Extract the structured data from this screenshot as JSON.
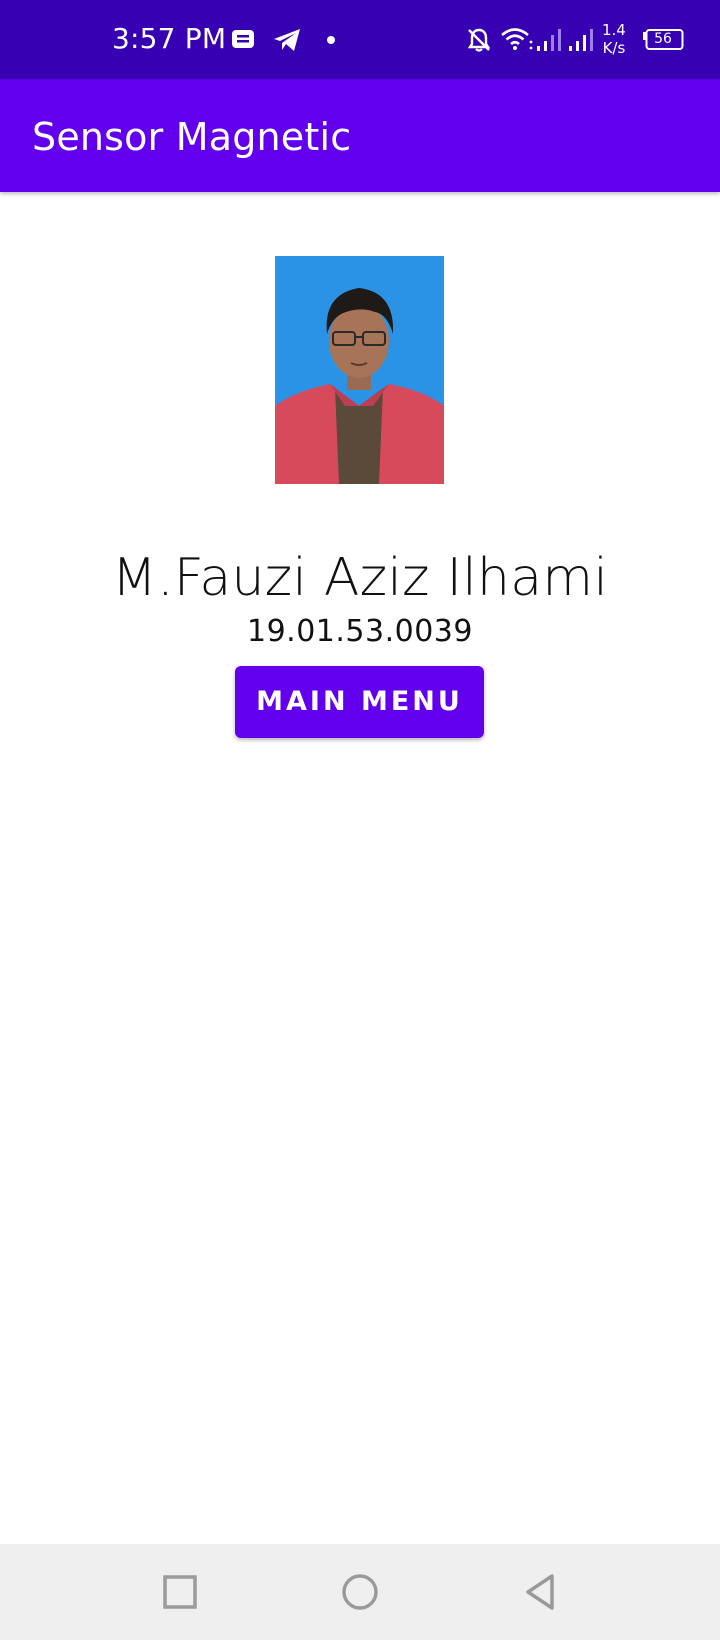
{
  "status_bar": {
    "time": "3:57 PM",
    "net_speed_value": "1.4",
    "net_speed_unit": "K/s",
    "battery_level": "56",
    "icons": [
      "message-icon",
      "telegram-icon",
      "dot-icon",
      "bell-off-icon",
      "wifi-icon",
      "signal-icon",
      "signal-icon-2",
      "battery-icon"
    ]
  },
  "app_bar": {
    "title": "Sensor Magnetic"
  },
  "profile": {
    "name": "M.Fauzi Aziz Ilhami",
    "student_id": "19.01.53.0039",
    "photo": "profile-photo"
  },
  "actions": {
    "main_menu_label": "MAIN MENU"
  },
  "nav_bar": {
    "items": [
      "recents-button",
      "home-button",
      "back-button"
    ]
  },
  "colors": {
    "status_bar": "#3700b3",
    "primary": "#6200ee",
    "nav_bar": "#efefef",
    "text": "#111111"
  }
}
